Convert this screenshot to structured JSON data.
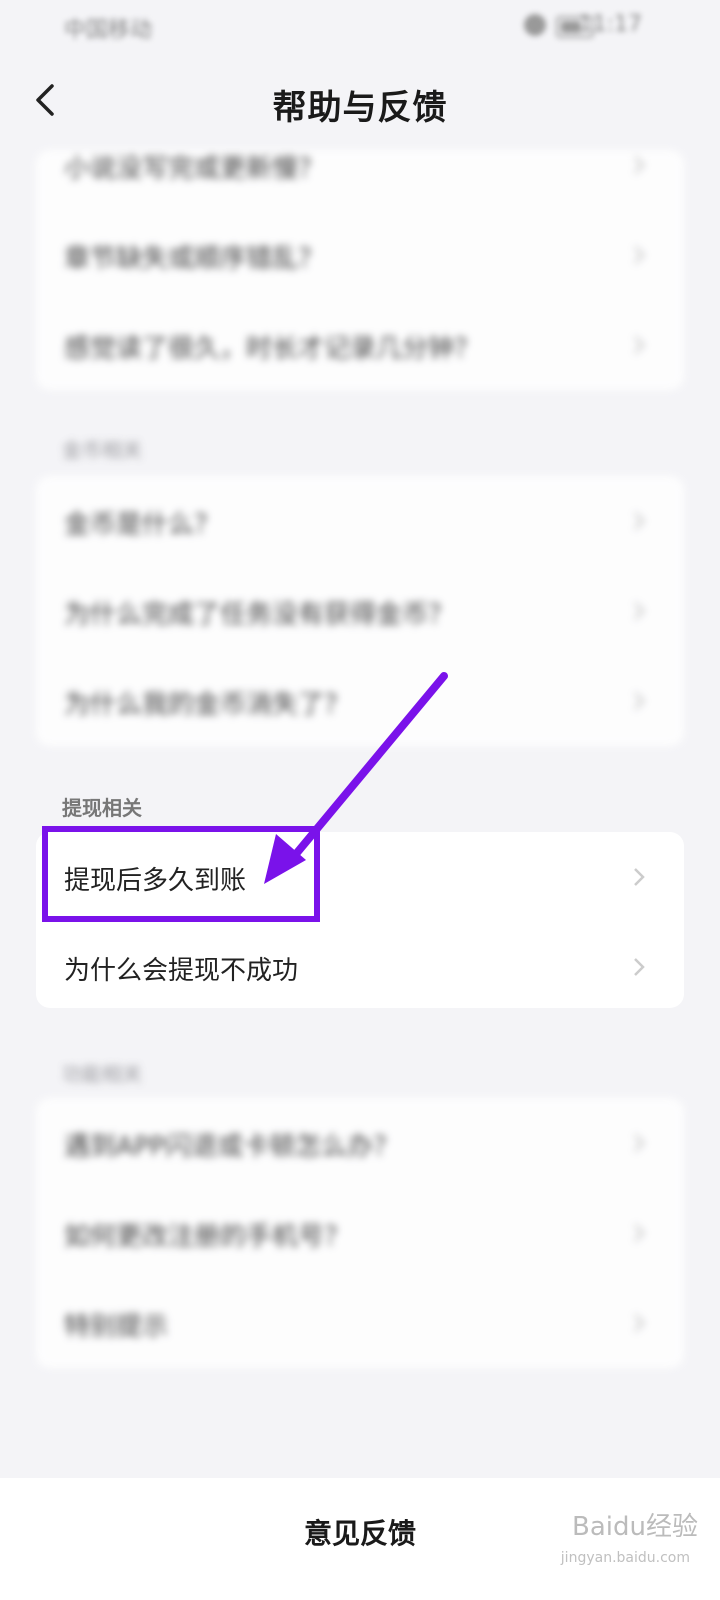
{
  "status_bar": {
    "carrier": "中国移动",
    "time": "11:17"
  },
  "header": {
    "title": "帮助与反馈"
  },
  "sections": [
    {
      "title": "",
      "items": [
        "小说没写完或更新慢？",
        "章节缺失或顺序错乱？",
        "感觉读了很久，时长才记录几分钟？"
      ]
    },
    {
      "title": "金币相关",
      "items": [
        "金币是什么？",
        "为什么完成了任务没有获得金币？",
        "为什么我的金币消失了？"
      ]
    },
    {
      "title": "提现相关",
      "items": [
        "提现后多久到账",
        "为什么会提现不成功"
      ]
    },
    {
      "title": "功能相关",
      "items": [
        "遇到APP闪退或卡顿怎么办？",
        "如何更改注册的手机号？",
        "特别提示"
      ]
    }
  ],
  "bottom": {
    "feedback_label": "意见反馈"
  },
  "watermark": {
    "brand": "Baidu经验",
    "url": "jingyan.baidu.com"
  },
  "colors": {
    "highlight": "#7a12ea",
    "background": "#f4f4f7"
  }
}
